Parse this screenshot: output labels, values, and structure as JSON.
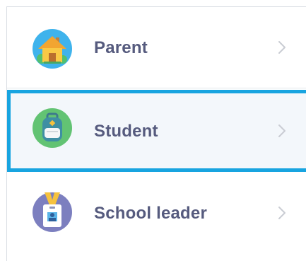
{
  "roles": [
    {
      "label": "Parent",
      "icon": "house-icon",
      "selected": false
    },
    {
      "label": "Student",
      "icon": "backpack-icon",
      "selected": true
    },
    {
      "label": "School leader",
      "icon": "id-badge-icon",
      "selected": false
    }
  ],
  "colors": {
    "selection_border": "#18a4e0",
    "selection_fill": "#f3f7fb",
    "label_text": "#565b7e",
    "chevron": "#c9ccd3"
  }
}
